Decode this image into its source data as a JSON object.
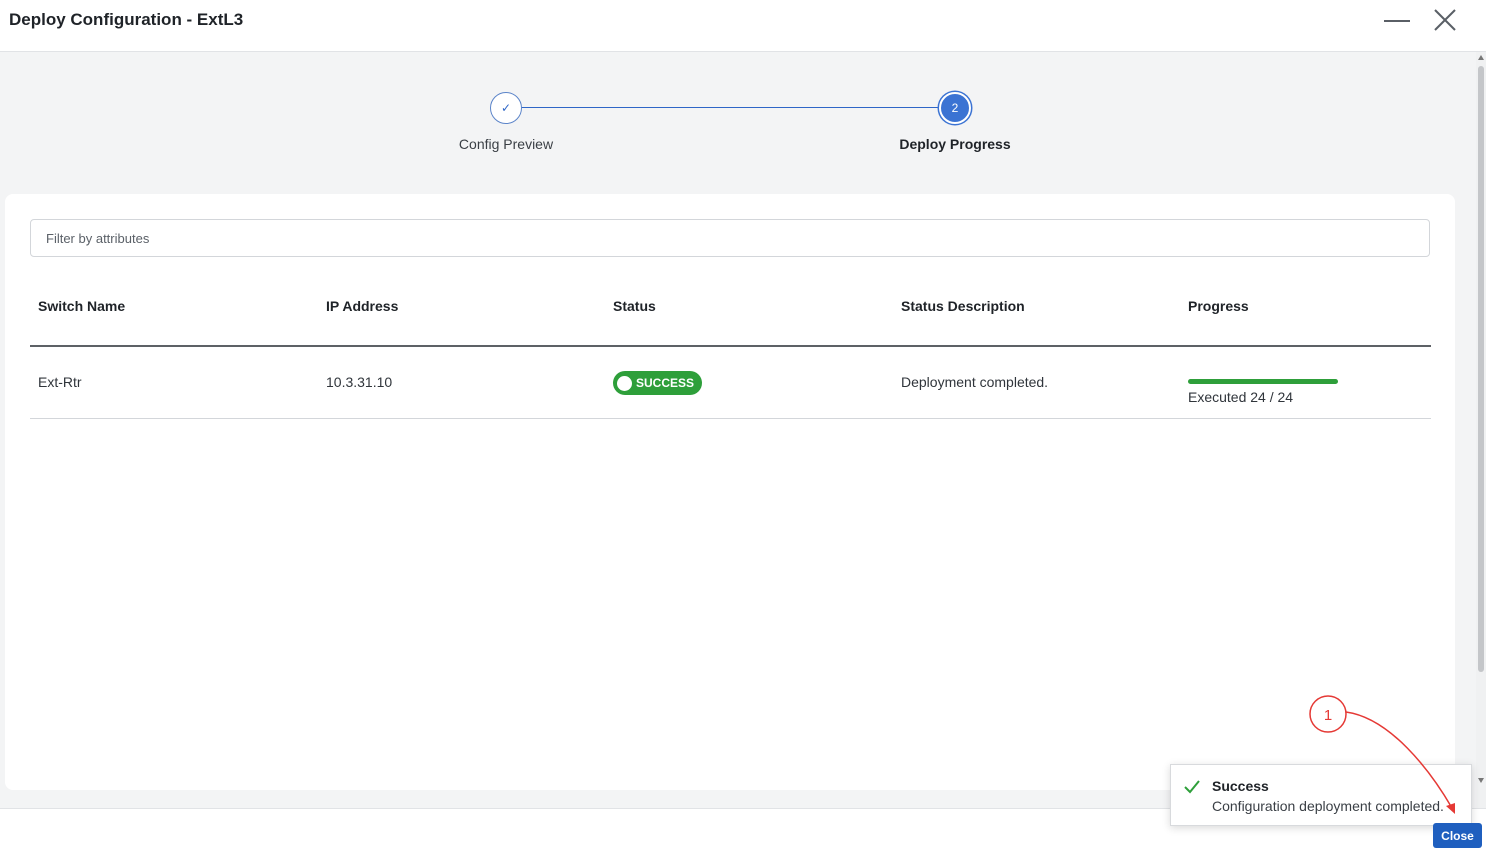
{
  "window": {
    "title": "Deploy Configuration - ExtL3"
  },
  "stepper": {
    "steps": [
      {
        "label": "Config Preview",
        "marker": "✓",
        "state": "done"
      },
      {
        "label": "Deploy Progress",
        "marker": "2",
        "state": "active"
      }
    ]
  },
  "filter": {
    "placeholder": "Filter by attributes",
    "value": ""
  },
  "table": {
    "columns": [
      "Switch Name",
      "IP Address",
      "Status",
      "Status Description",
      "Progress"
    ],
    "rows": [
      {
        "switch_name": "Ext-Rtr",
        "ip_address": "10.3.31.10",
        "status": "SUCCESS",
        "status_description": "Deployment completed.",
        "progress_text": "Executed 24 / 24",
        "progress_fraction": 1.0
      }
    ]
  },
  "toast": {
    "title": "Success",
    "message": "Configuration deployment completed.",
    "icon": "check-icon"
  },
  "footer": {
    "close_label": "Close"
  },
  "annotation": {
    "number": "1",
    "color": "#e53935"
  },
  "colors": {
    "accent": "#3b73d3",
    "success": "#2e9f3a",
    "primary_button": "#1f5fbf"
  }
}
